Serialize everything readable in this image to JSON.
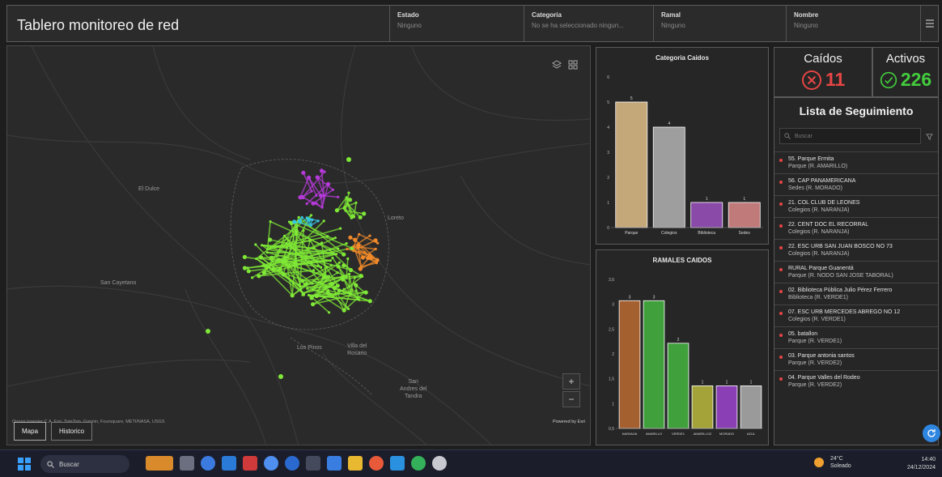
{
  "header": {
    "title": "Tablero monitoreo de red",
    "filters": [
      {
        "label": "Estado",
        "value": "Ninguno"
      },
      {
        "label": "Categoria",
        "value": "No se ha seleccionado ningun..."
      },
      {
        "label": "Ramal",
        "value": "Ninguno"
      },
      {
        "label": "Nombre",
        "value": "Ninguno"
      }
    ],
    "menu_icon": "hamburger-menu-icon"
  },
  "map": {
    "place_labels": [
      "El Dulce",
      "Loreto",
      "San Cayetano",
      "San\nAndres del\nTandra",
      "Los Pinos",
      "Villa del\nRosario"
    ],
    "attribution": "Ongan Ingenier C.A. Esri, TomTom, Garmin, Foursquare, METI/NASA, USGS",
    "powered_by": "Powered by Esri",
    "tabs": [
      "Mapa",
      "Historico"
    ],
    "active_tab": "Mapa",
    "accent_colors": {
      "green": "#7fe836",
      "orange": "#f08a2a",
      "purple": "#b53ad9",
      "cyan": "#35c6e0",
      "red": "#e64545"
    }
  },
  "chart_data": [
    {
      "type": "bar",
      "title": "Categoria Caidos",
      "categories": [
        "Parque",
        "Colegios",
        "Biblioteca",
        "Sedes"
      ],
      "values": [
        5,
        4,
        1,
        1
      ],
      "colors": [
        "#c4a87a",
        "#9e9e9e",
        "#8a4aa8",
        "#c07a7a"
      ],
      "ylim": [
        0,
        6
      ],
      "yticks": [
        "0",
        "1",
        "2",
        "3",
        "4",
        "5",
        "6"
      ]
    },
    {
      "type": "bar",
      "title": "RAMALES CAIDOS",
      "categories": [
        "NARANJA",
        "AMARILLO",
        "VERDE1",
        "AMARILLO2",
        "MORADO",
        "AZUL"
      ],
      "values": [
        3,
        3,
        2,
        1,
        1,
        1
      ],
      "colors": [
        "#a5602f",
        "#3fa03c",
        "#3fa03c",
        "#a3a33a",
        "#8a3fb5",
        "#9a9a9a"
      ],
      "ylim": [
        0,
        3.5
      ],
      "yticks": [
        "0,5",
        "1",
        "1,5",
        "2",
        "2,5",
        "3",
        "3,5"
      ]
    }
  ],
  "kpis": {
    "caidos": {
      "label": "Caídos",
      "value": "11",
      "icon": "error-circle-icon",
      "color": "#e64545"
    },
    "activos": {
      "label": "Activos",
      "value": "226",
      "icon": "check-circle-icon",
      "color": "#43cc3c"
    }
  },
  "tracking": {
    "title": "Lista de Seguimiento",
    "search_placeholder": "Buscar",
    "items": [
      {
        "name": "55. Parque Ermita",
        "sub": "Parque (R. AMARILLO)"
      },
      {
        "name": "56. CAP PANAMERICANA",
        "sub": "Sedes (R. MORADO)"
      },
      {
        "name": "21. COL CLUB DE LEONES",
        "sub": "Colegios (R. NARANJA)"
      },
      {
        "name": "22. CENT DOC EL RECORRAL",
        "sub": "Colegios (R. NARANJA)"
      },
      {
        "name": "22. ESC URB SAN JUAN BOSCO NO 73",
        "sub": "Colegios (R. NARANJA)"
      },
      {
        "name": "RURAL Parque Guanentá",
        "sub": "Parque (R. NODO SAN JOSE TABORAL)"
      },
      {
        "name": "02. Biblioteca Pública Julio Pérez Ferrero",
        "sub": "Biblioteca (R. VERDE1)"
      },
      {
        "name": "07. ESC URB MERCEDES ABREGO NO 12",
        "sub": "Colegios (R. VERDE1)"
      },
      {
        "name": "05. batallon",
        "sub": "Parque (R. VERDE1)"
      },
      {
        "name": "03. Parque antonia santos",
        "sub": "Parque (R. VERDE2)"
      },
      {
        "name": "04. Parque Valles del Rodeo",
        "sub": "Parque (R. VERDE2)"
      }
    ]
  },
  "taskbar": {
    "search_label": "Buscar",
    "weather_temp": "24°C",
    "weather_text": "Soleado",
    "time": "14:40",
    "date": "24/12/2024"
  }
}
